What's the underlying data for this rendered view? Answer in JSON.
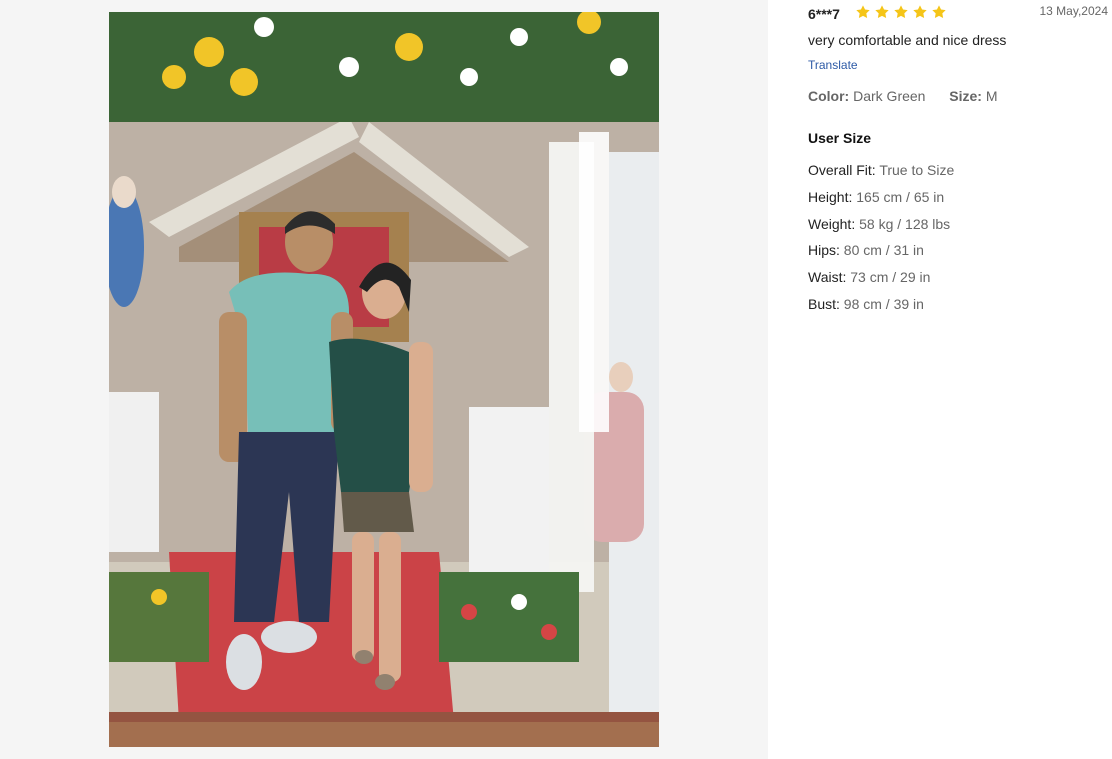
{
  "review": {
    "reviewer": "6***7",
    "rating": 5,
    "rating_max": 5,
    "date": "13 May,2024",
    "comment": "very comfortable and nice dress",
    "translate_label": "Translate",
    "color_label": "Color:",
    "color_value": "Dark Green",
    "size_label": "Size:",
    "size_value": "M",
    "user_size_title": "User Size",
    "user_size": [
      {
        "label": "Overall Fit:",
        "value": "True to Size"
      },
      {
        "label": "Height:",
        "value": "165 cm / 65 in"
      },
      {
        "label": "Weight:",
        "value": "58 kg / 128 lbs"
      },
      {
        "label": "Hips:",
        "value": "80 cm / 31 in"
      },
      {
        "label": "Waist:",
        "value": "73 cm / 29 in"
      },
      {
        "label": "Bust:",
        "value": "98 cm / 39 in"
      }
    ]
  },
  "colors": {
    "star": "#f5c518",
    "link": "#2d5aa6",
    "muted": "#666666",
    "panel_bg": "#f5f5f5"
  }
}
